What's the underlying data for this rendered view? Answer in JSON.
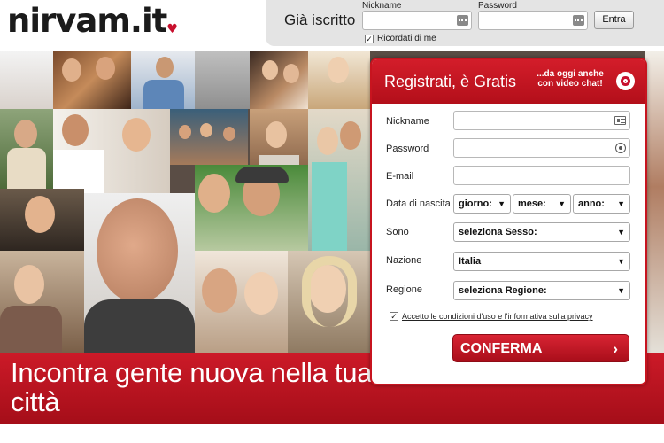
{
  "header": {
    "logo_text": "nirvam",
    "logo_suffix": ".it",
    "logo_heart": "♥"
  },
  "login": {
    "title": "Già iscritto",
    "nickname_label": "Nickname",
    "password_label": "Password",
    "submit_label": "Entra",
    "remember_label": "Ricordati di me",
    "remember_checked": true
  },
  "hero": {
    "slogan": "Incontra gente nuova nella tua città"
  },
  "registration": {
    "title": "Registrati, è Gratis",
    "video_note": "...da oggi anche con video chat!",
    "fields": {
      "nickname_label": "Nickname",
      "password_label": "Password",
      "email_label": "E-mail",
      "birthdate_label": "Data di nascita",
      "day_value": "giorno:",
      "month_value": "mese:",
      "year_value": "anno:",
      "gender_label": "Sono",
      "gender_value": "seleziona Sesso:",
      "country_label": "Nazione",
      "country_value": "Italia",
      "region_label": "Regione",
      "region_value": "seleziona Regione:"
    },
    "terms_label": "Accetto le condizioni d'uso e l'informativa sulla privacy",
    "terms_checked": true,
    "submit_label": "CONFERMA",
    "submit_arrow": "›"
  },
  "colors": {
    "brand_red": "#c8102e",
    "panel_gray": "#e4e4e4"
  }
}
